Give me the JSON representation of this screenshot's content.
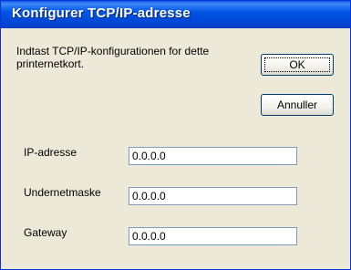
{
  "window": {
    "title": "Konfigurer TCP/IP-adresse"
  },
  "intro_text": "Indtast TCP/IP-konfigurationen for dette printernetkort.",
  "buttons": {
    "ok": "OK",
    "cancel": "Annuller"
  },
  "fields": [
    {
      "label": "IP-adresse",
      "value": "0.0.0.0"
    },
    {
      "label": "Undernetmaske",
      "value": "0.0.0.0"
    },
    {
      "label": "Gateway",
      "value": "0.0.0.0"
    }
  ]
}
